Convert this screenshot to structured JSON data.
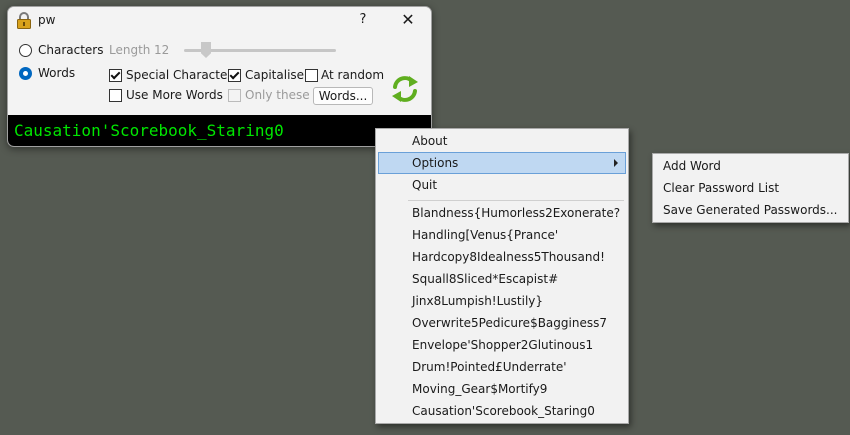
{
  "window": {
    "title": "pw",
    "help_label": "?",
    "close_label": "✕",
    "mode_options": [
      {
        "label": "Characters",
        "selected": false
      },
      {
        "label": "Words",
        "selected": true
      }
    ],
    "length": {
      "label": "Length",
      "value": "12",
      "enabled": false
    },
    "checkboxes": [
      {
        "label": "Special Characters",
        "checked": true,
        "enabled": true
      },
      {
        "label": "Capitalise",
        "checked": true,
        "enabled": true
      },
      {
        "label": "At random",
        "checked": false,
        "enabled": true
      },
      {
        "label": "Use More Words",
        "checked": false,
        "enabled": true
      },
      {
        "label": "Only these",
        "checked": false,
        "enabled": false
      }
    ],
    "words_button": "Words...",
    "password": "Causation'Scorebook_Staring0"
  },
  "context_menu": {
    "top_items": [
      "About",
      "Options",
      "Quit"
    ],
    "highlighted": "Options",
    "history": [
      "Blandness{Humorless2Exonerate?",
      "Handling[Venus{Prance'",
      "Hardcopy8Idealness5Thousand!",
      "Squall8Sliced*Escapist#",
      "Jinx8Lumpish!Lustily}",
      "Overwrite5Pedicure$Bagginess7",
      "Envelope'Shopper2Glutinous1",
      "Drum!Pointed£Underrate'",
      "Moving_Gear$Mortify9",
      "Causation'Scorebook_Staring0"
    ]
  },
  "options_submenu": {
    "items": [
      "Add Word",
      "Clear Password List",
      "Save Generated Passwords..."
    ]
  },
  "colors": {
    "desktop": "#555a52",
    "password_text": "#00e600",
    "accent": "#0067c0",
    "menu_highlight": "#bfd8f2"
  }
}
